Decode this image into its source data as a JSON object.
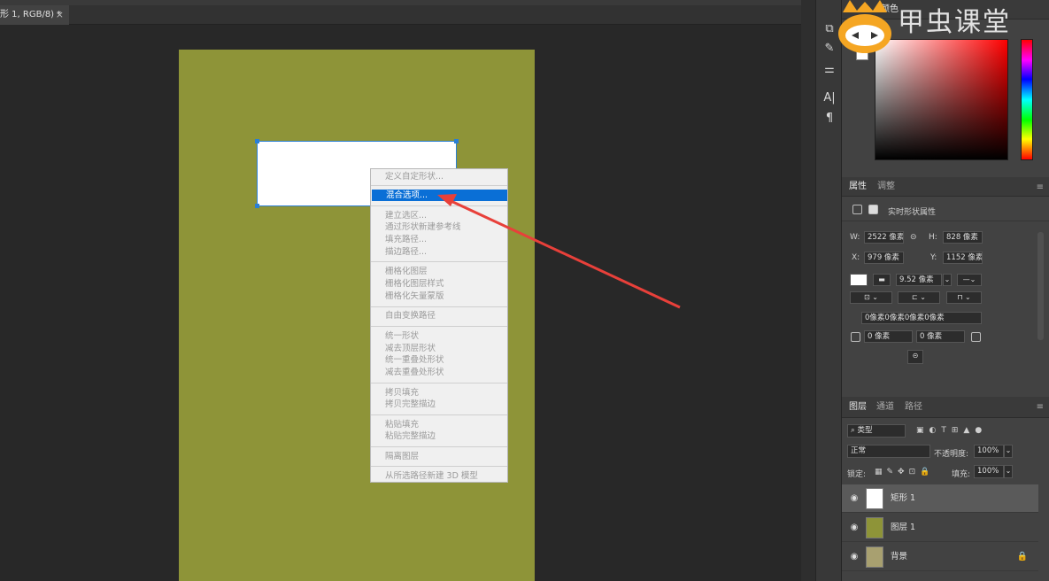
{
  "document_tab": {
    "title": "形 1, RGB/8) *",
    "close": "×"
  },
  "context_menu": {
    "items": [
      {
        "label": "定义自定形状...",
        "enabled": false,
        "active": false
      },
      {
        "label": "混合选项...",
        "enabled": true,
        "active": true
      },
      {
        "label": "建立选区...",
        "enabled": false,
        "active": false
      },
      {
        "label": "通过形状新建参考线",
        "enabled": false,
        "active": false
      },
      {
        "label": "填充路径...",
        "enabled": false,
        "active": false
      },
      {
        "label": "描边路径...",
        "enabled": false,
        "active": false
      },
      {
        "label": "栅格化图层",
        "enabled": false,
        "active": false
      },
      {
        "label": "栅格化图层样式",
        "enabled": false,
        "active": false
      },
      {
        "label": "栅格化矢量蒙版",
        "enabled": false,
        "active": false
      },
      {
        "label": "自由变换路径",
        "enabled": false,
        "active": false
      },
      {
        "label": "统一形状",
        "enabled": false,
        "active": false
      },
      {
        "label": "减去顶层形状",
        "enabled": false,
        "active": false
      },
      {
        "label": "统一重叠处形状",
        "enabled": false,
        "active": false
      },
      {
        "label": "减去重叠处形状",
        "enabled": false,
        "active": false
      },
      {
        "label": "拷贝填充",
        "enabled": false,
        "active": false
      },
      {
        "label": "拷贝完整描边",
        "enabled": false,
        "active": false
      },
      {
        "label": "粘贴填充",
        "enabled": false,
        "active": false
      },
      {
        "label": "粘贴完整描边",
        "enabled": false,
        "active": false
      },
      {
        "label": "隔离图层",
        "enabled": false,
        "active": false
      },
      {
        "label": "从所选路径新建 3D 模型",
        "enabled": false,
        "active": false
      }
    ]
  },
  "color_panel": {
    "tab": "颜色",
    "fg_color": "#ffffff"
  },
  "properties_panel": {
    "tabs": [
      "属性",
      "调整"
    ],
    "subtitle": "实时形状属性",
    "w_label": "W:",
    "w_value": "2522 像素",
    "h_label": "H:",
    "h_value": "828 像素",
    "x_label": "X:",
    "x_value": "979 像素",
    "y_label": "Y:",
    "y_value": "1152 像素",
    "stroke_width": "9.52 像素",
    "radii": "0像素0像素0像素0像素",
    "corner1": "0 像素",
    "corner2": "0 像素"
  },
  "layers_panel": {
    "tabs": [
      "图层",
      "通道",
      "路径"
    ],
    "filter_label": "类型",
    "blend_mode": "正常",
    "opacity_label": "不透明度:",
    "opacity_value": "100%",
    "lock_label": "锁定:",
    "fill_label": "填充:",
    "fill_value": "100%",
    "layers": [
      {
        "name": "矩形 1",
        "selected": true
      },
      {
        "name": "图层 1",
        "selected": false
      },
      {
        "name": "背景",
        "selected": false,
        "locked": true
      }
    ]
  },
  "watermark": {
    "text": "甲虫课堂"
  },
  "colors": {
    "artboard": "#8e9438",
    "menu_highlight": "#0a6fd6",
    "arrow": "#e8403a",
    "selection": "#2a7fd4"
  },
  "icons": {
    "panel_menu": "panel-menu-icon",
    "eye": "eye-icon",
    "lock": "lock-icon",
    "link": "link-icon"
  }
}
